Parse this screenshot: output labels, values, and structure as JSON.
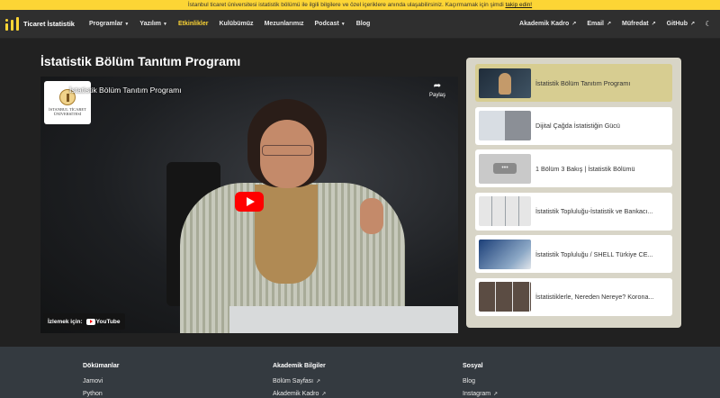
{
  "announcement": {
    "text": "İstanbul ticaret üniversitesi istatistik bölümü ile ilgili bilgilere ve özel içeriklere anında ulaşabilirsiniz. Kaçırmamak için şimdi",
    "link": "takip edin!"
  },
  "nav": {
    "brand": "Ticaret İstatistik",
    "left": [
      {
        "label": "Programlar",
        "dropdown": true
      },
      {
        "label": "Yazılım",
        "dropdown": true
      },
      {
        "label": "Etkinlikler",
        "active": true
      },
      {
        "label": "Kulübümüz"
      },
      {
        "label": "Mezunlarımız"
      },
      {
        "label": "Podcast",
        "dropdown": true
      },
      {
        "label": "Blog"
      }
    ],
    "right": [
      {
        "label": "Akademik Kadro",
        "external": true
      },
      {
        "label": "Email",
        "external": true
      },
      {
        "label": "Müfredat",
        "external": true
      },
      {
        "label": "GitHub",
        "external": true
      }
    ],
    "theme_icon": "moon-icon"
  },
  "page": {
    "title": "İstatistik Bölüm Tanıtım Programı"
  },
  "video": {
    "title": "İstatistik Bölüm Tanıtım Programı",
    "channel_badge": "İSTANBUL TİCARET ÜNİVERSİTESİ",
    "share_label": "Paylaş",
    "watch_on": "İzlemek için:",
    "watch_platform": "YouTube"
  },
  "playlist": [
    {
      "title": "İstatistik Bölüm Tanıtım Programı",
      "active": true
    },
    {
      "title": "Dijital Çağda İstatistiğin Gücü"
    },
    {
      "title": "1 Bölüm 3 Bakış | İstatistik Bölümü"
    },
    {
      "title": "İstatistik Topluluğu-İstatistik ve Bankacı..."
    },
    {
      "title": "İstatistik Topluluğu / SHELL Türkiye CE..."
    },
    {
      "title": "İstatistiklerle, Nereden Nereye? Korona..."
    }
  ],
  "footer": {
    "columns": [
      {
        "heading": "Dökümanlar",
        "links": [
          "Jamovi",
          "Python"
        ]
      },
      {
        "heading": "Akademik Bilgiler",
        "links": [
          "Bölüm Sayfası",
          "Akademik Kadro"
        ]
      },
      {
        "heading": "Sosyal",
        "links": [
          "Blog",
          "Instagram"
        ]
      }
    ]
  },
  "colors": {
    "accent": "#fcd535",
    "active_playlist": "#d7cd91",
    "youtube_red": "#ff0000"
  }
}
